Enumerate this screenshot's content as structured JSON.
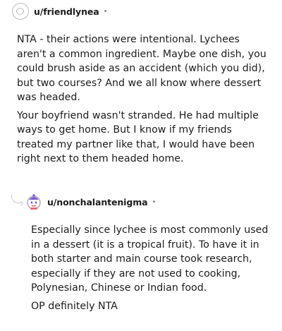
{
  "comments": [
    {
      "username": "u/friendlynea",
      "separator": "•",
      "avatar_icon": "default-avatar-icon",
      "paragraphs": [
        "NTA - their actions were intentional. Lychees aren't a common ingredient. Maybe one dish, you could brush aside as an accident (which you did), but two courses? And we all know where dessert was headed.",
        "Your boyfriend wasn't stranded. He had multiple ways to get home. But I know if my friends treated my partner like that, I would have been right next to them headed home."
      ]
    },
    {
      "username": "u/nonchalantenigma",
      "separator": "•",
      "avatar_icon": "snoo-avatar-icon",
      "paragraphs": [
        "Especially since lychee is most commonly used in a dessert (it is a tropical fruit). To have it in both starter and main course took research, especially if they are not used to cooking, Polynesian, Chinese or Indian food.",
        "OP definitely NTA"
      ]
    }
  ],
  "colors": {
    "text": "#1c1c1c",
    "meta": "#7c7c7c",
    "thread_line": "#c6c9cc",
    "avatar_outline": "#b9bcc0",
    "snoo_accent": "#7e5bd6"
  }
}
